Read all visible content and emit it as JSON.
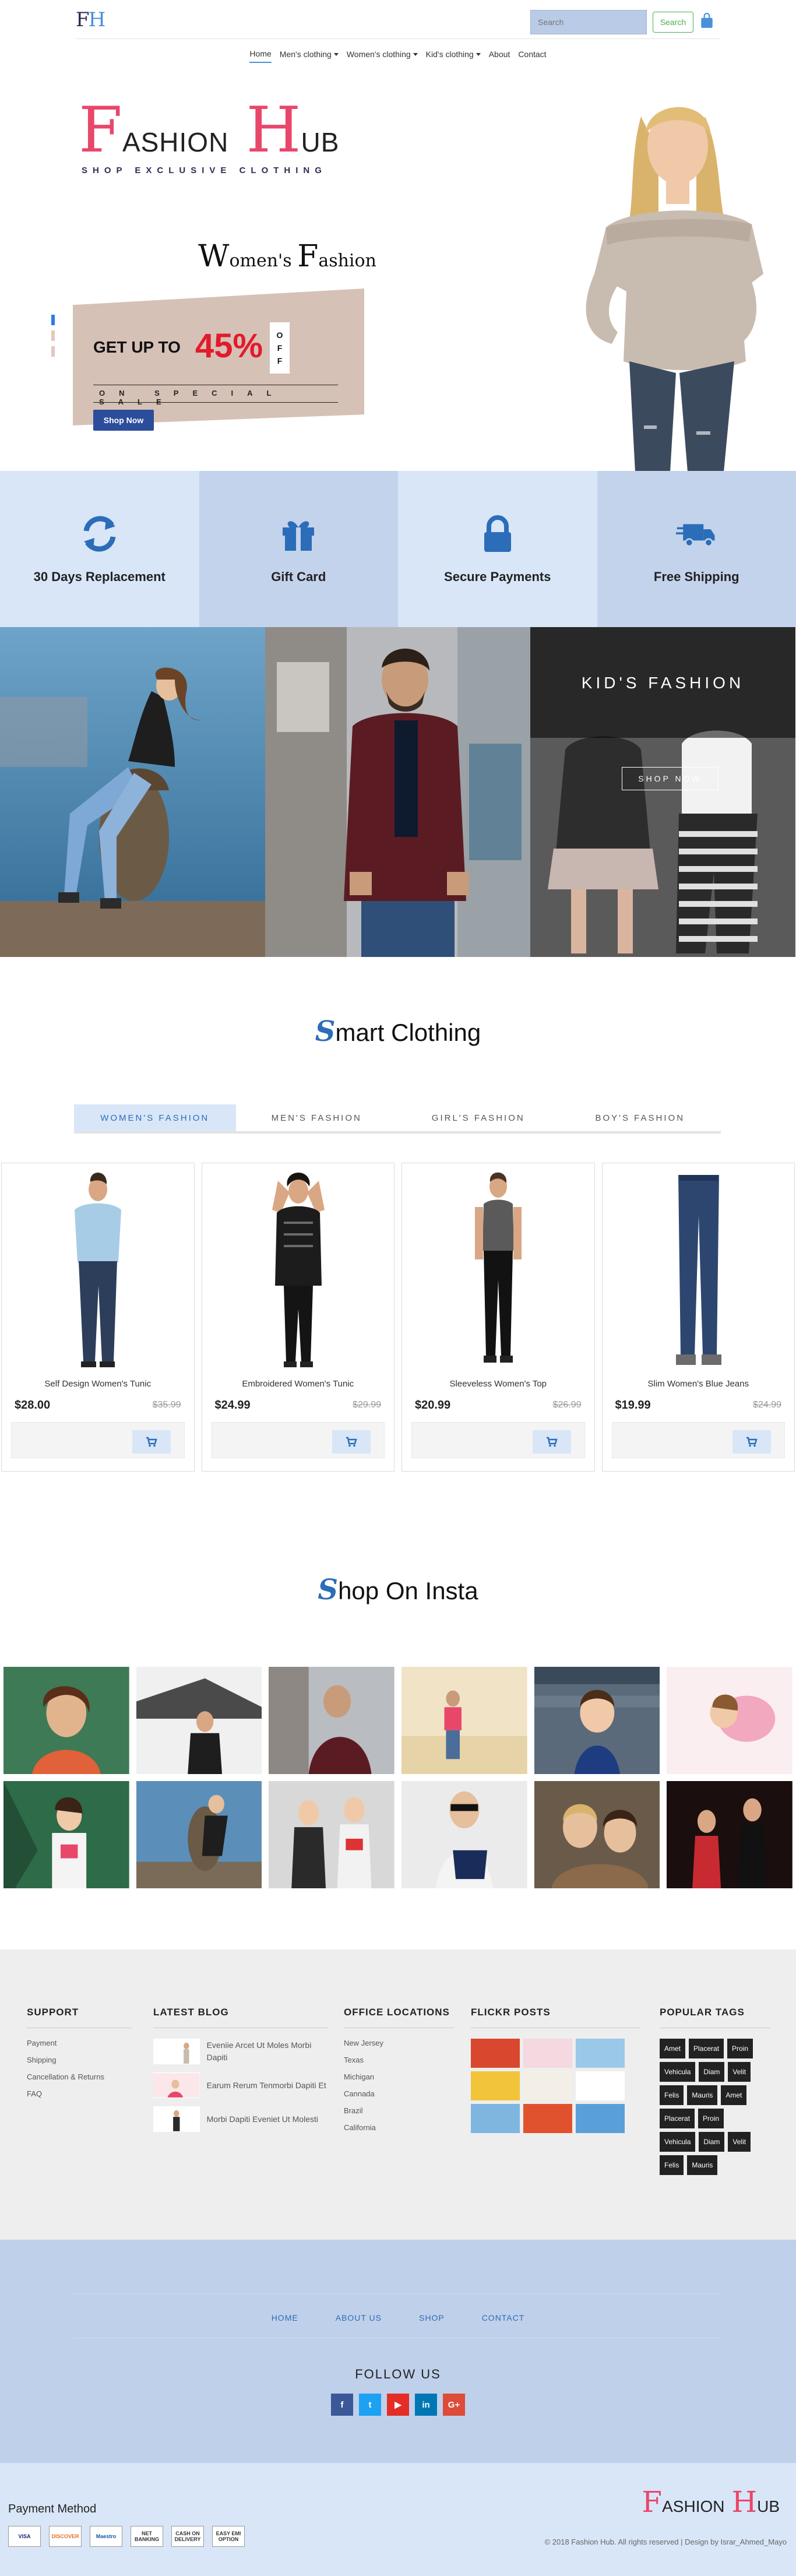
{
  "header": {
    "logo_f": "F",
    "logo_h": "H",
    "search_placeholder": "Search",
    "search_button": "Search"
  },
  "nav": [
    {
      "label": "Home",
      "active": true,
      "dropdown": false
    },
    {
      "label": "Men's clothing",
      "active": false,
      "dropdown": true
    },
    {
      "label": "Women's clothing",
      "active": false,
      "dropdown": true
    },
    {
      "label": "Kid's clothing",
      "active": false,
      "dropdown": true
    },
    {
      "label": "About",
      "active": false,
      "dropdown": false
    },
    {
      "label": "Contact",
      "active": false,
      "dropdown": false
    }
  ],
  "banner": {
    "brand_cap1": "F",
    "brand_rest1": "ASHION",
    "brand_cap2": "H",
    "brand_rest2": "UB",
    "brand_sub": "SHOP EXCLUSIVE CLOTHING",
    "womens_w": "W",
    "womens_rest1": "omen's",
    "womens_f": "F",
    "womens_rest2": "ashion",
    "offer_upto": "GET UP TO",
    "offer_pct": "45%",
    "offer_off": [
      "O",
      "F",
      "F"
    ],
    "offer_sale": "ON SPECIAL SALE",
    "shop_now": "Shop Now"
  },
  "features": [
    {
      "label": "30 Days Replacement",
      "icon": "refresh-icon"
    },
    {
      "label": "Gift Card",
      "icon": "gift-icon"
    },
    {
      "label": "Secure Payments",
      "icon": "lock-icon"
    },
    {
      "label": "Free Shipping",
      "icon": "truck-icon"
    }
  ],
  "tiles": {
    "kids_title": "KID'S FASHION",
    "kids_button": "SHOP NOW"
  },
  "smart": {
    "initial": "S",
    "rest": "mart Clothing"
  },
  "tabs": [
    {
      "label": "WOMEN'S FASHION",
      "active": true
    },
    {
      "label": "MEN'S FASHION",
      "active": false
    },
    {
      "label": "GIRL'S FASHION",
      "active": false
    },
    {
      "label": "BOY'S FASHION",
      "active": false
    }
  ],
  "products": [
    {
      "name": "Self Design Women's Tunic",
      "price": "$28.00",
      "old_price": "$35.99",
      "top": "#a7cce6",
      "bottom": "#2c3e5a"
    },
    {
      "name": "Embroidered Women's Tunic",
      "price": "$24.99",
      "old_price": "$29.99",
      "top": "#1c1c1c",
      "bottom": "#141414"
    },
    {
      "name": "Sleeveless Women's Top",
      "price": "$20.99",
      "old_price": "$26.99",
      "top": "#5a5a5a",
      "bottom": "#121212"
    },
    {
      "name": "Slim Women's Blue Jeans",
      "price": "$19.99",
      "old_price": "$24.99",
      "top": "#f3f3f3",
      "bottom": "#2d4670"
    }
  ],
  "insta": {
    "initial": "S",
    "rest": "hop On Insta"
  },
  "footer": {
    "support_title": "SUPPORT",
    "support_links": [
      "Payment",
      "Shipping",
      "Cancellation & Returns",
      "FAQ"
    ],
    "blog_title": "LATEST BLOG",
    "blogs": [
      "Eveniie Arcet Ut Moles Morbi Dapiti",
      "Earum Rerum Tenmorbi Dapiti Et",
      "Morbi Dapiti Eveniet Ut Molesti"
    ],
    "office_title": "OFFICE LOCATIONS",
    "offices": [
      "New Jersey",
      "Texas",
      "Michigan",
      "Cannada",
      "Brazil",
      "California"
    ],
    "flickr_title": "FLICKR POSTS",
    "tags_title": "POPULAR TAGS",
    "tags": [
      "Amet",
      "Placerat",
      "Proin",
      "Vehicula",
      "Diam",
      "Velit",
      "Felis",
      "Mauris",
      "Amet",
      "Placerat",
      "Proin",
      "Vehicula",
      "Diam",
      "Velit",
      "Felis",
      "Mauris"
    ]
  },
  "bottom_nav": {
    "links": [
      "HOME",
      "ABOUT US",
      "SHOP",
      "CONTACT"
    ],
    "follow": "FOLLOW US",
    "social": [
      {
        "icon": "facebook-icon",
        "glyph": "f",
        "color": "#3b5998"
      },
      {
        "icon": "twitter-icon",
        "glyph": "t",
        "color": "#1da1f2"
      },
      {
        "icon": "youtube-icon",
        "glyph": "▶",
        "color": "#e52d27"
      },
      {
        "icon": "linkedin-icon",
        "glyph": "in",
        "color": "#0077b5"
      },
      {
        "icon": "google-plus-icon",
        "glyph": "G+",
        "color": "#dd4b39"
      }
    ]
  },
  "bottom": {
    "payment_title": "Payment Method",
    "payments": [
      "VISA",
      "DISCOVER",
      "Maestro",
      "NET BANKING",
      "CASH ON DELIVERY",
      "EASY EMI OPTION"
    ],
    "logo_cap1": "F",
    "logo_rest1": "ASHION",
    "logo_cap2": "H",
    "logo_rest2": "UB",
    "copyright": "© 2018 Fashion Hub. All rights reserved | Design by Israr_Ahmed_Mayo"
  },
  "colors": {
    "brand_pink": "#e8476a",
    "brand_blue": "#2b6db8",
    "feature_light": "#d8e6f8",
    "feature_dark": "#c3d3ec",
    "footer_blue": "#bfd0ea"
  }
}
